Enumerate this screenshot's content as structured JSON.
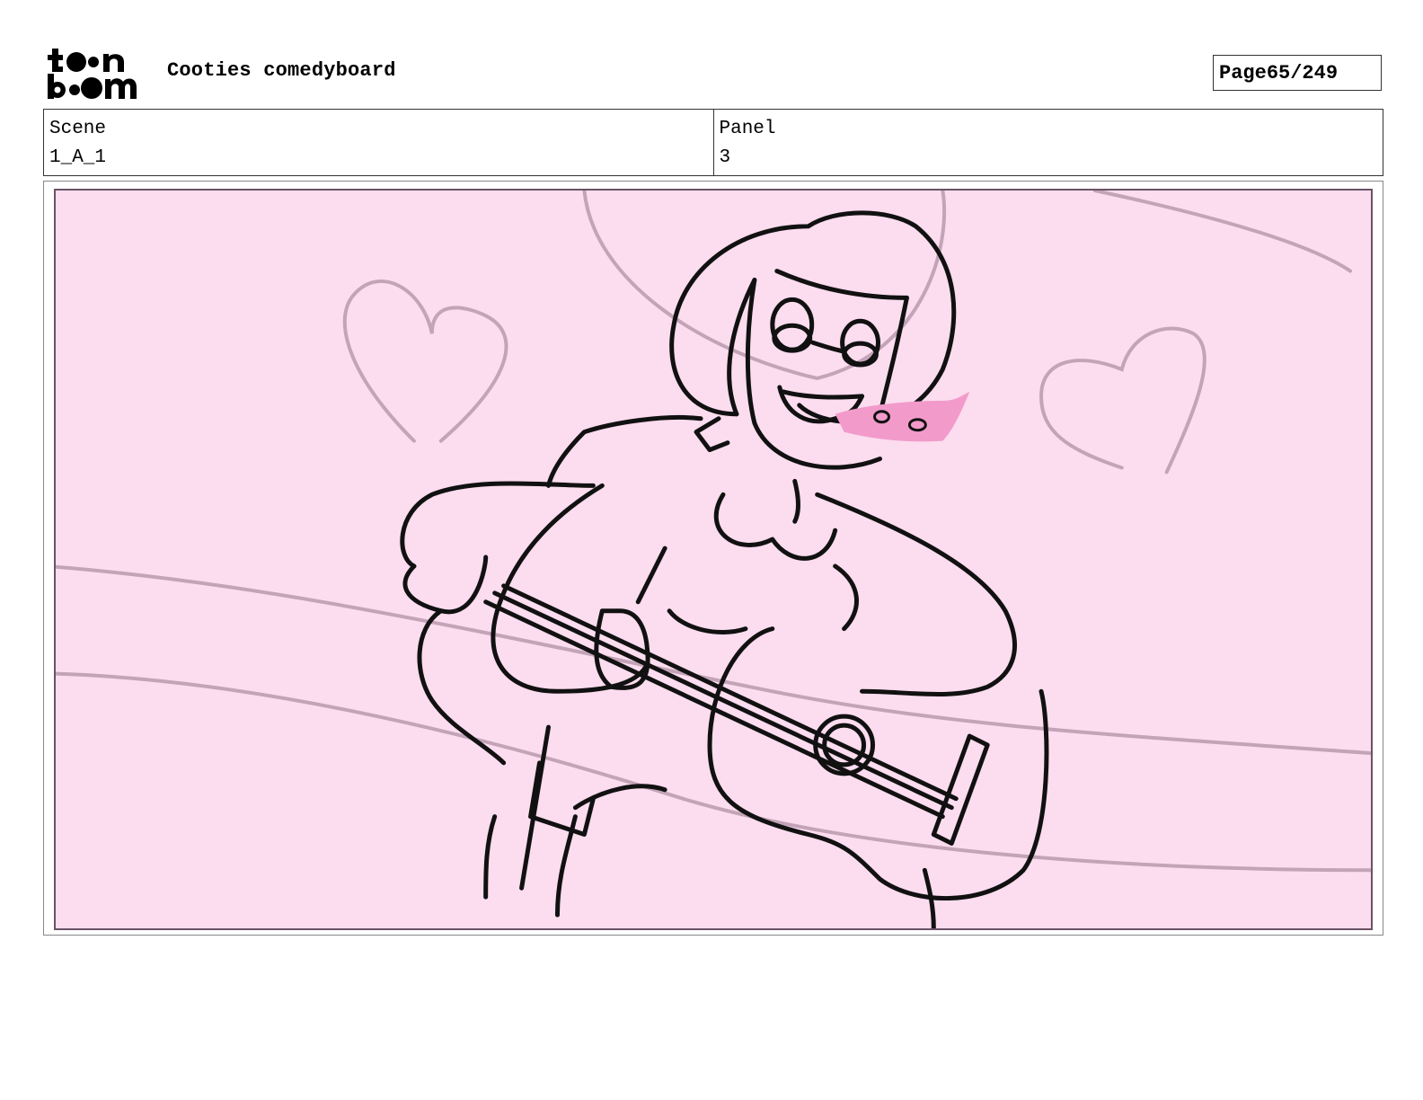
{
  "header": {
    "logo_text": "toon boom",
    "doc_title": "Cooties comedyboard",
    "page_label": "Page",
    "page_number": "65/249"
  },
  "info": {
    "scene_label": "Scene",
    "scene_value": "1_A_1",
    "panel_label": "Panel",
    "panel_value": "3"
  },
  "panel": {
    "background_color": "#fcdcef",
    "border_color": "#6b5366",
    "blush_color": "#f29bcb",
    "guide_color": "#c3a3b7"
  }
}
